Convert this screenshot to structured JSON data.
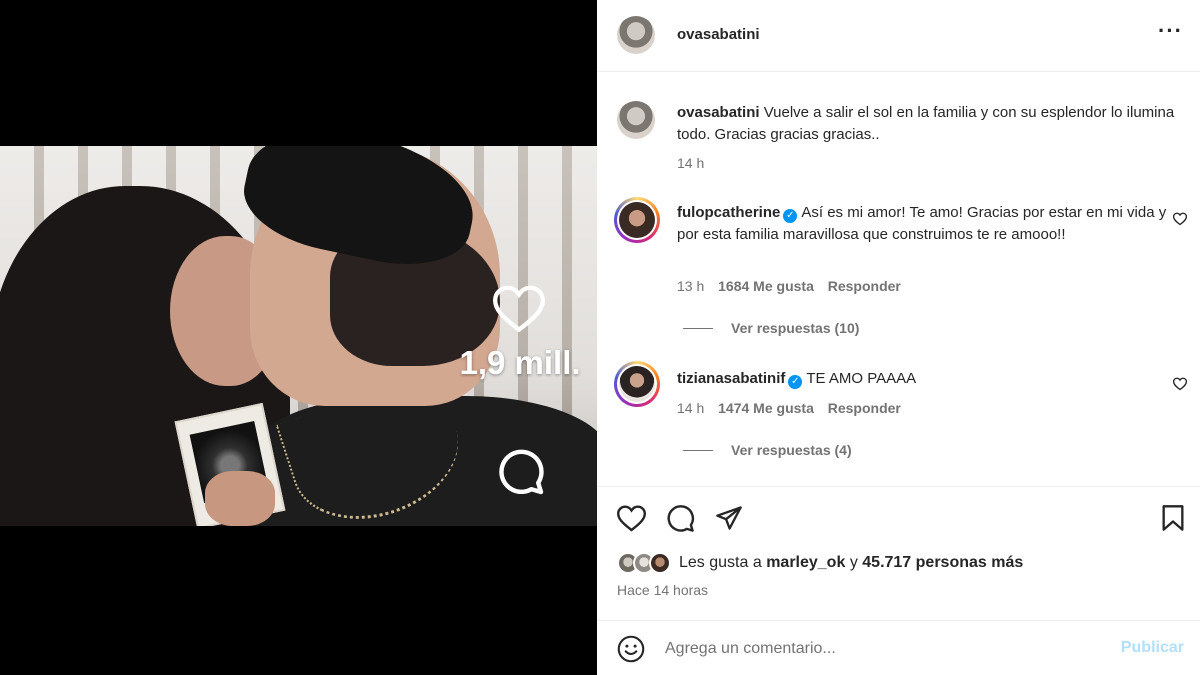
{
  "post": {
    "author": "ovasabatini",
    "more_icon": "more-horizontal-icon",
    "overlay": {
      "like_icon": "heart-outline-icon",
      "like_count": "1,9 mill.",
      "comment_icon": "comment-bubble-icon"
    }
  },
  "caption": {
    "user": "ovasabatini",
    "text": "Vuelve a salir el sol en la familia y con su esplendor lo ilumina todo. Gracias gracias gracias..",
    "time": "14 h"
  },
  "comments": [
    {
      "user": "fulopcatherine",
      "verified": true,
      "text": "Así es mi amor! Te amo! Gracias por estar en mi vida y por esta familia maravillosa que construimos te re amooo!!",
      "time": "13 h",
      "likes": "1684 Me gusta",
      "reply": "Responder",
      "view_replies": "Ver respuestas (10)"
    },
    {
      "user": "tizianasabatinif",
      "verified": true,
      "text": "TE AMO PAAAA",
      "time": "14 h",
      "likes": "1474 Me gusta",
      "reply": "Responder",
      "view_replies": "Ver respuestas (4)"
    }
  ],
  "actions": {
    "icons": [
      "heart-icon",
      "comment-icon",
      "share-icon",
      "save-bookmark-icon"
    ],
    "likes_prefix": "Les gusta a",
    "likes_user": "marley_ok",
    "likes_connector": "y",
    "likes_others": "45.717 personas más",
    "posted_ago": "Hace 14 horas"
  },
  "composer": {
    "placeholder": "Agrega un comentario...",
    "publish_label": "Publicar",
    "emoji_icon": "emoji-smile-icon"
  },
  "colors": {
    "accent_blue": "#0095f6",
    "publish_disabled": "#b2dffc",
    "text_primary": "#262626",
    "text_secondary": "#737373"
  }
}
